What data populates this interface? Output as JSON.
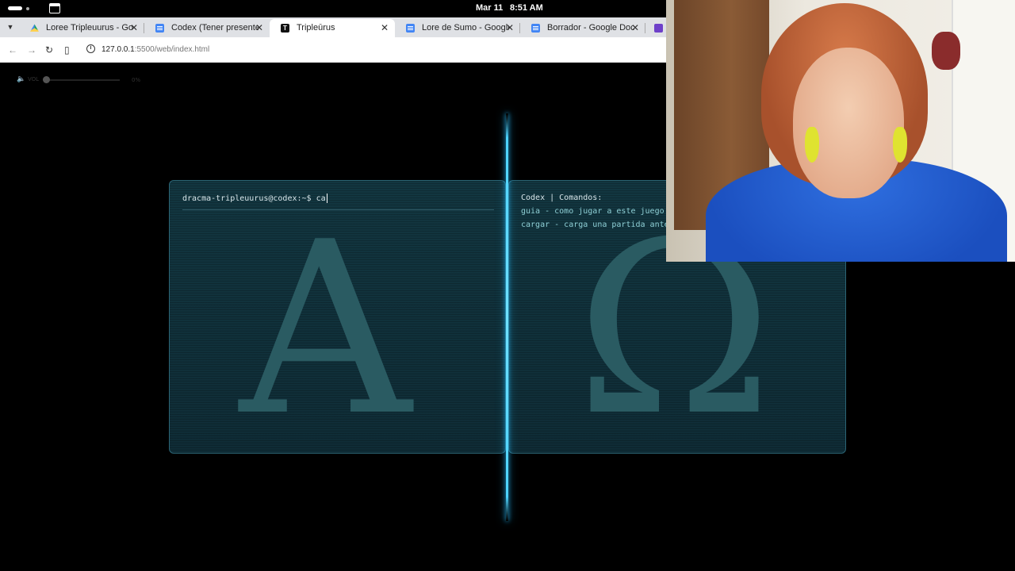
{
  "system": {
    "date": "Mar 11",
    "time": "8:51 AM"
  },
  "tabs": [
    {
      "title": "Loree Tripleuurus - Goog",
      "icon": "google-drive-icon"
    },
    {
      "title": "Codex (Tener presente u",
      "icon": "google-docs-icon"
    },
    {
      "title": "Tripleūrus",
      "icon": "t-app-icon",
      "active": true
    },
    {
      "title": "Lore de Sumo - Google D",
      "icon": "google-docs-icon"
    },
    {
      "title": "Borrador - Google Docs",
      "icon": "google-docs-icon"
    }
  ],
  "address": {
    "host": "127.0.0.1",
    "path": ":5500/web/index.html"
  },
  "volume": {
    "label": "VOL",
    "percent_text": "0%",
    "level": 0
  },
  "terminal": {
    "prompt": "dracma-tripleuurus@codex:~$",
    "input": "ca",
    "glyph": "Α"
  },
  "codex": {
    "header": "Codex | Comandos:",
    "commands": [
      "guia - como jugar a este juego",
      "cargar - carga una partida anter"
    ],
    "glyph": "Ω"
  },
  "colors": {
    "divider": "#4cd2ff",
    "panel_bg": "#123640",
    "glyph": "#2a5b62",
    "command_text": "#8fd0d6"
  }
}
